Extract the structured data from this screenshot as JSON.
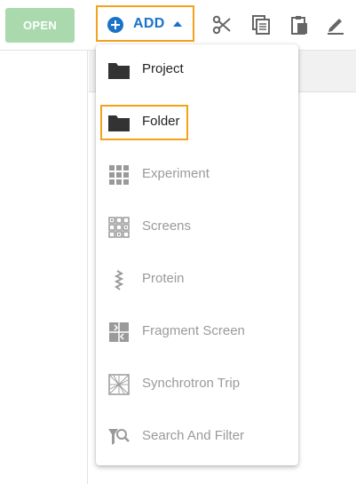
{
  "toolbar": {
    "open_label": "OPEN",
    "add_label": "ADD",
    "colors": {
      "accent": "#1a73c8",
      "highlight": "#f5a21b",
      "open_disabled": "#a9d9ad"
    },
    "icons": [
      "cut-icon",
      "copy-icon",
      "paste-icon",
      "edit-icon"
    ]
  },
  "menu": {
    "items": [
      {
        "label": "Project",
        "icon": "folder-icon",
        "enabled": true
      },
      {
        "label": "Folder",
        "icon": "folder-icon",
        "enabled": true,
        "highlighted": true
      },
      {
        "label": "Experiment",
        "icon": "grid-icon",
        "enabled": false
      },
      {
        "label": "Screens",
        "icon": "screens-icon",
        "enabled": false
      },
      {
        "label": "Protein",
        "icon": "protein-icon",
        "enabled": false
      },
      {
        "label": "Fragment Screen",
        "icon": "fragment-screen-icon",
        "enabled": false
      },
      {
        "label": "Synchrotron Trip",
        "icon": "synchrotron-icon",
        "enabled": false
      },
      {
        "label": "Search And Filter",
        "icon": "search-filter-icon",
        "enabled": false
      }
    ]
  }
}
